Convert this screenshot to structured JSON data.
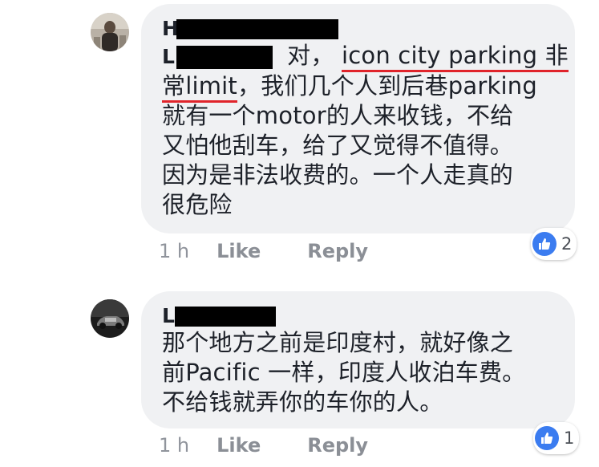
{
  "comments": [
    {
      "author_initial": "H",
      "name_initial": "L",
      "text_line1_a": "对，",
      "text_line1_b": "icon city parking 非",
      "text_line2_a": "常limit",
      "text_line2_b": "，我们几个人到后巷parking",
      "text_line3": "就有一个motor的人来收钱，不给",
      "text_line4": "又怕他刮车，给了又觉得不值得。",
      "text_line5": "因为是非法收费的。一个人走真的",
      "text_line6": "很危险",
      "time": "1 h",
      "like_label": "Like",
      "reply_label": "Reply",
      "reaction_icon": "thumbs-up-icon",
      "reaction_count": "2"
    },
    {
      "author_initial": "L",
      "text_line1": "那个地方之前是印度村，就好像之",
      "text_line2": "前Pacific 一样，印度人收泊车费。",
      "text_line3": "不给钱就弄你的车你的人。",
      "time": "1 h",
      "like_label": "Like",
      "reply_label": "Reply",
      "reaction_icon": "thumbs-up-icon",
      "reaction_count": "1"
    }
  ],
  "colors": {
    "bubble_bg": "#f0f1f3",
    "text": "#1d2129",
    "meta_text": "#90949c",
    "like_blue": "#3b7cf0",
    "underline_red": "#e0242b",
    "redaction": "#000000"
  }
}
